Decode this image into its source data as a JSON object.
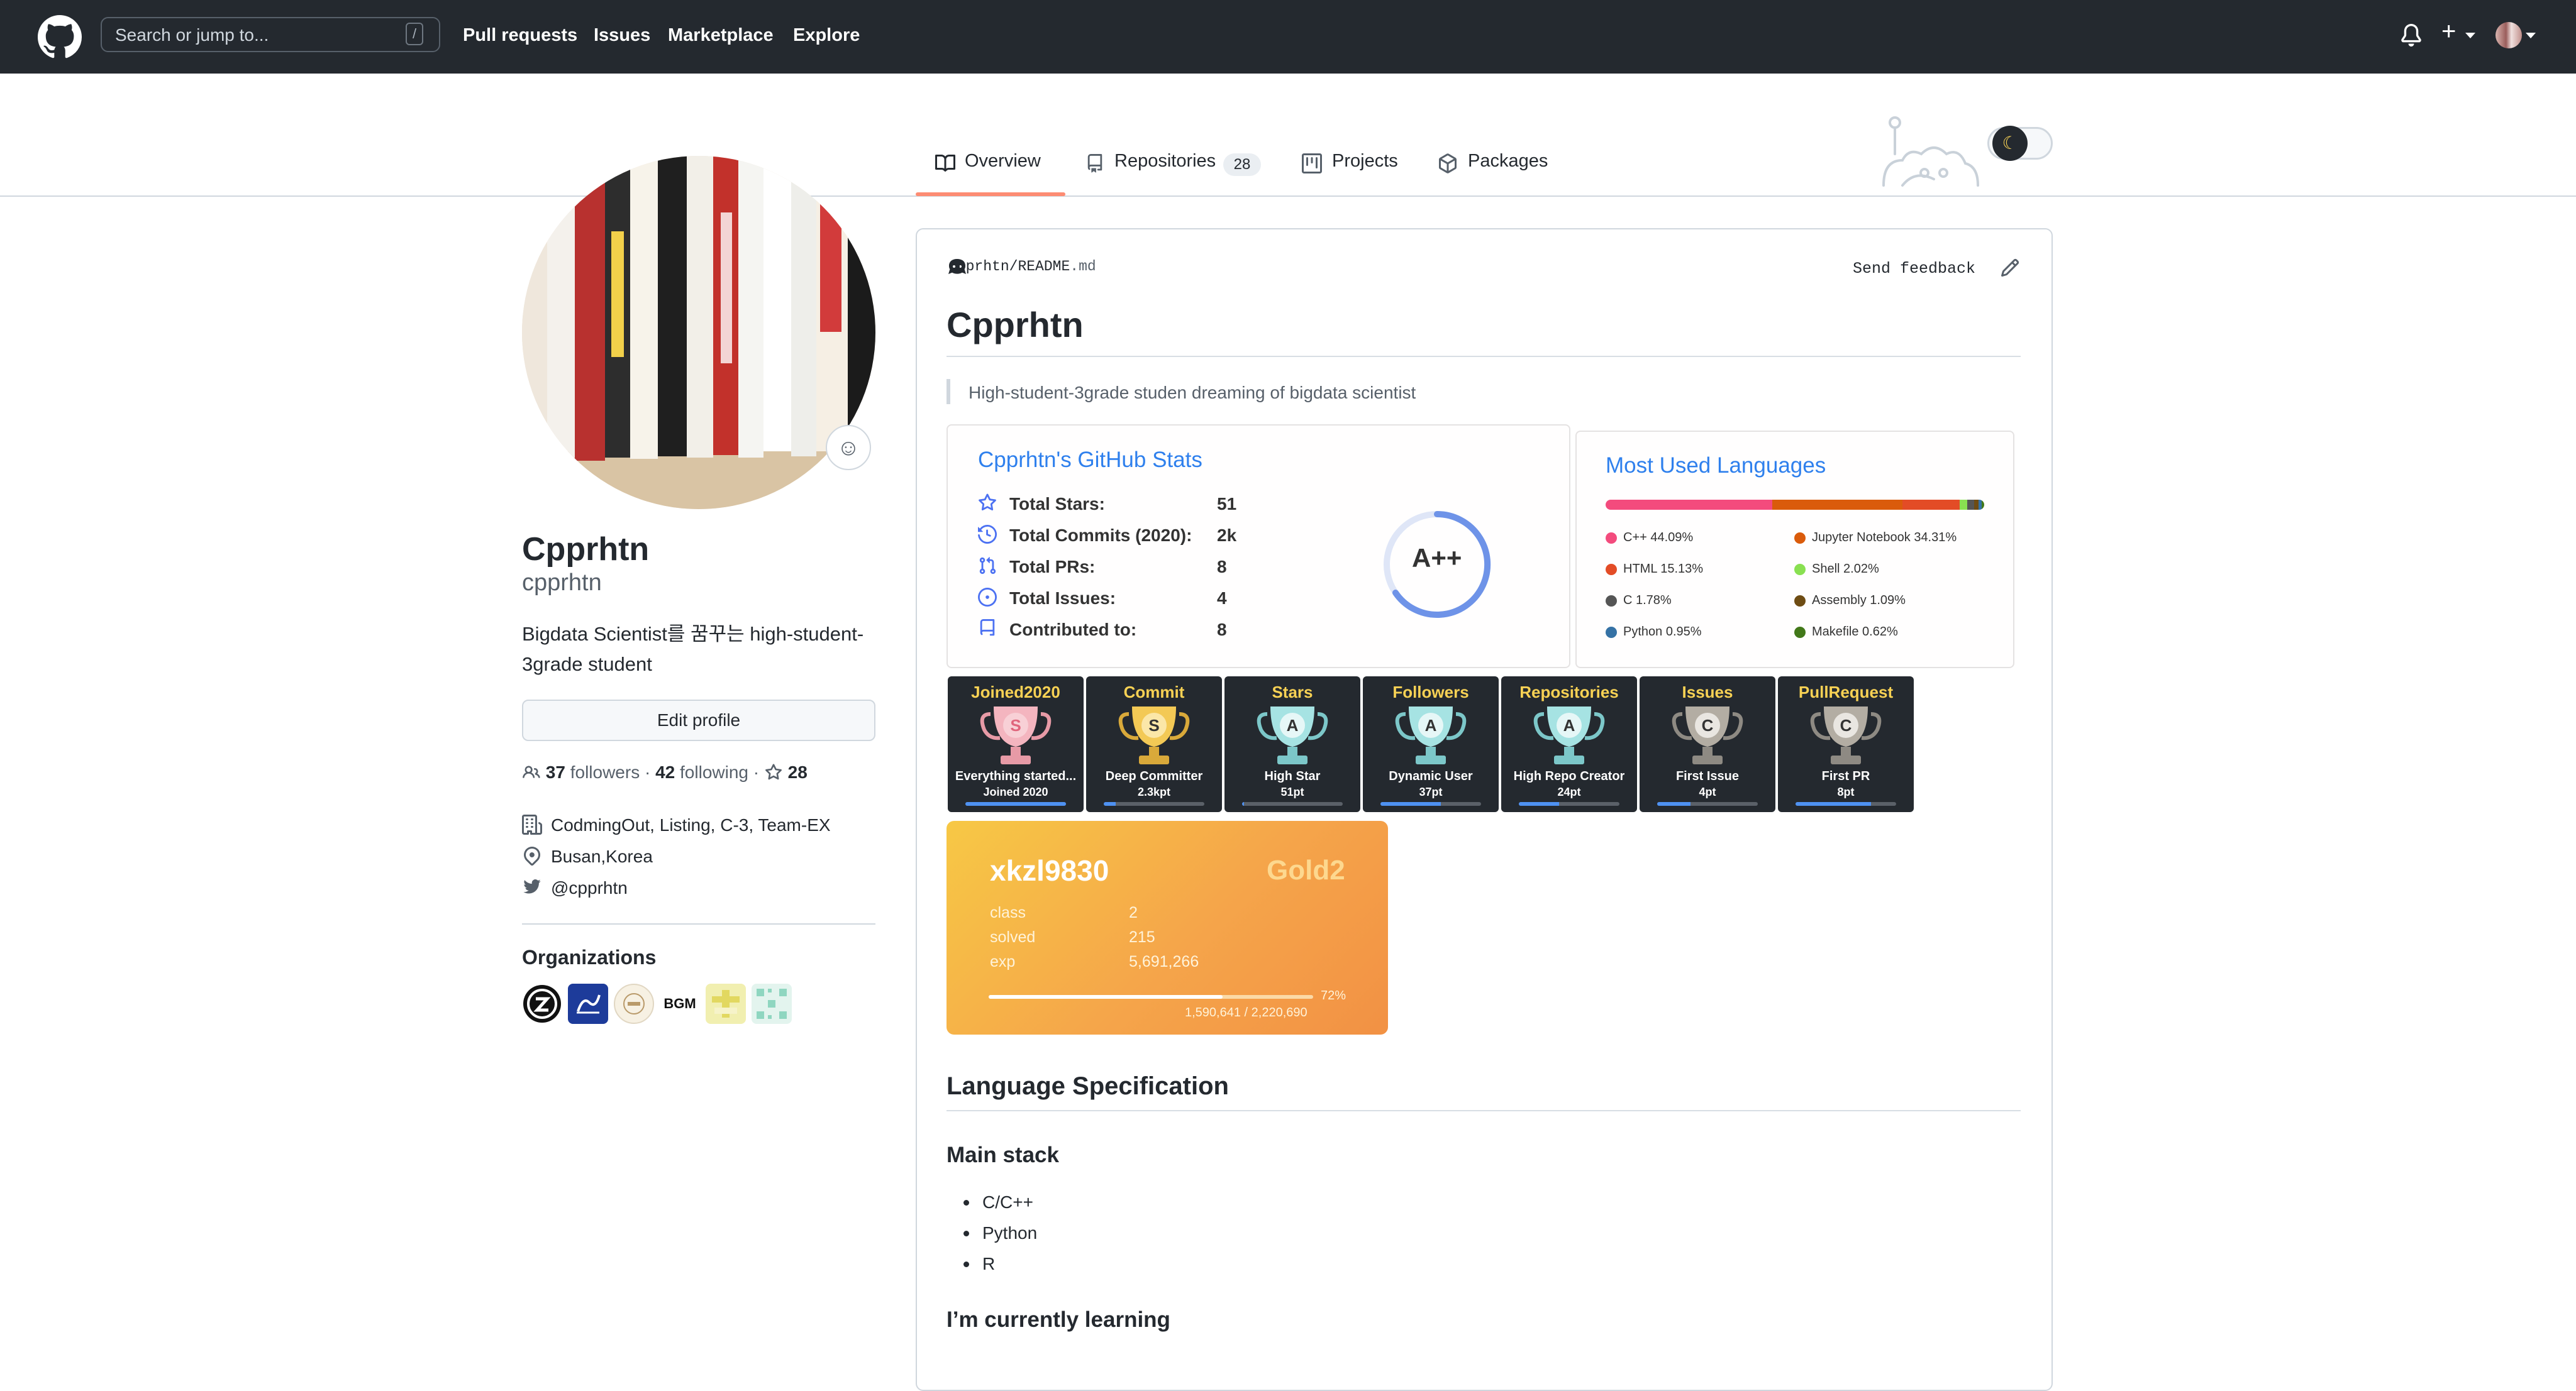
{
  "header": {
    "search_placeholder": "Search or jump to...",
    "search_shortcut": "/",
    "nav": [
      "Pull requests",
      "Issues",
      "Marketplace",
      "Explore"
    ]
  },
  "tabs": {
    "overview": "Overview",
    "repositories": "Repositories",
    "repositories_count": "28",
    "projects": "Projects",
    "packages": "Packages"
  },
  "profile": {
    "name": "Cpprhtn",
    "username": "cpprhtn",
    "bio": "Bigdata Scientist를 꿈꾸는 high-student-3grade student",
    "edit_button": "Edit profile",
    "followers_count": "37",
    "followers_label": "followers",
    "following_count": "42",
    "following_label": "following",
    "stars_count": "28",
    "company": "CodmingOut, Listing, C-3, Team-EX",
    "location": "Busan,Korea",
    "twitter": "@cpprhtn",
    "organizations_title": "Organizations",
    "org_bgm_label": "BGM"
  },
  "readme": {
    "path_user": "cpprhtn",
    "path_sep": "/",
    "path_file": "README",
    "path_ext": ".md",
    "send_feedback": "Send feedback",
    "title": "Cpprhtn",
    "quote": "High-student-3grade studen dreaming of bigdata scientist"
  },
  "stats": {
    "title": "Cpprhtn's GitHub Stats",
    "rows": [
      {
        "label": "Total Stars:",
        "value": "51"
      },
      {
        "label": "Total Commits (2020):",
        "value": "2k"
      },
      {
        "label": "Total PRs:",
        "value": "8"
      },
      {
        "label": "Total Issues:",
        "value": "4"
      },
      {
        "label": "Contributed to:",
        "value": "8"
      }
    ],
    "rank": "A++"
  },
  "languages": {
    "title": "Most Used Languages",
    "items": [
      {
        "label": "C++ 44.09%",
        "color": "#f34b7d",
        "pct": 44.09
      },
      {
        "label": "Jupyter Notebook 34.31%",
        "color": "#DA5B0B",
        "pct": 34.31
      },
      {
        "label": "HTML 15.13%",
        "color": "#e34c26",
        "pct": 15.13
      },
      {
        "label": "Shell 2.02%",
        "color": "#89e051",
        "pct": 2.02
      },
      {
        "label": "C 1.78%",
        "color": "#555555",
        "pct": 1.78
      },
      {
        "label": "Assembly 1.09%",
        "color": "#6E4C13",
        "pct": 1.09
      },
      {
        "label": "Python 0.95%",
        "color": "#3572A5",
        "pct": 0.95
      },
      {
        "label": "Makefile 0.62%",
        "color": "#427819",
        "pct": 0.62
      }
    ]
  },
  "trophies": [
    {
      "title": "Joined2020",
      "rank": "S",
      "desc": "Everything started...",
      "pt": "Joined 2020",
      "progress": 1.0
    },
    {
      "title": "Commit",
      "rank": "S",
      "desc": "Deep Committer",
      "pt": "2.3kpt",
      "progress": 0.12
    },
    {
      "title": "Stars",
      "rank": "A",
      "desc": "High Star",
      "pt": "51pt",
      "progress": 0.02
    },
    {
      "title": "Followers",
      "rank": "A",
      "desc": "Dynamic User",
      "pt": "37pt",
      "progress": 0.6
    },
    {
      "title": "Repositories",
      "rank": "A",
      "desc": "High Repo Creator",
      "pt": "24pt",
      "progress": 0.4
    },
    {
      "title": "Issues",
      "rank": "C",
      "desc": "First Issue",
      "pt": "4pt",
      "progress": 0.33
    },
    {
      "title": "PullRequest",
      "rank": "C",
      "desc": "First PR",
      "pt": "8pt",
      "progress": 0.75
    }
  ],
  "solved": {
    "user": "xkzl9830",
    "tier": "Gold2",
    "rows": [
      {
        "k": "class",
        "v": "2"
      },
      {
        "k": "solved",
        "v": "215"
      },
      {
        "k": "exp",
        "v": "5,691,266"
      }
    ],
    "progress_pct": "72%",
    "progress_nums": "1,590,641 / 2,220,690",
    "progress_fraction": 0.72
  },
  "spec": {
    "title": "Language Specification",
    "main_stack_title": "Main stack",
    "main_stack": [
      "C/C++",
      "Python",
      "R"
    ],
    "learning_title": "I’m currently learning"
  },
  "colors": {
    "header_bg": "#24292f",
    "tab_accent": "#fd8c73",
    "link_blue": "#2f80ed",
    "trophy_title": "#f7d154"
  },
  "icons": [
    "github-logo-icon",
    "bell-icon",
    "plus-icon",
    "book-icon",
    "repo-icon",
    "project-icon",
    "package-icon",
    "people-icon",
    "star-icon",
    "building-icon",
    "location-icon",
    "twitter-icon",
    "pencil-icon",
    "octocat-icon",
    "smiley-icon"
  ]
}
